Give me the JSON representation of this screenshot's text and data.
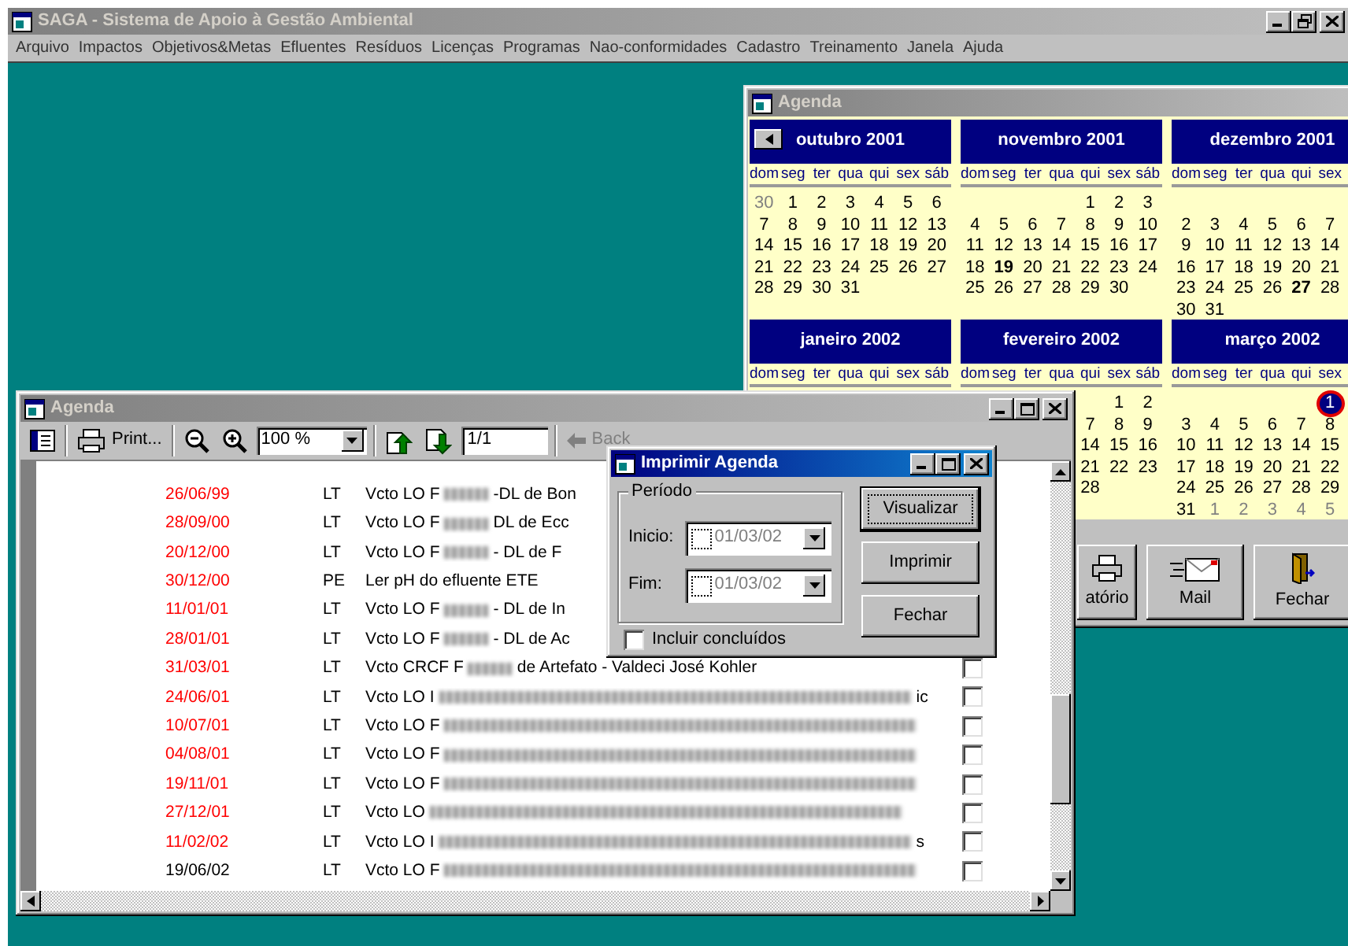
{
  "app": {
    "title": "SAGA - Sistema de Apoio à Gestão Ambiental",
    "active": false,
    "title_buttons": [
      {
        "kind": "minimize"
      },
      {
        "kind": "restore"
      },
      {
        "kind": "close"
      }
    ]
  },
  "menu": [
    "Arquivo",
    "Impactos",
    "Objetivos&Metas",
    "Efluentes",
    "Resíduos",
    "Licenças",
    "Programas",
    "Nao-conformidades",
    "Cadastro",
    "Treinamento",
    "Janela",
    "Ajuda"
  ],
  "calendar_window": {
    "title": "Agenda",
    "active": false,
    "months": [
      {
        "title": "outubro 2001",
        "prev_button": true,
        "weekdays": [
          "dom",
          "seg",
          "ter",
          "qua",
          "qui",
          "sex",
          "sáb"
        ],
        "weeks": [
          [
            {
              "kind": "day",
              "day": "30",
              "muted": true,
              "selected": false
            },
            {
              "kind": "day",
              "day": "1",
              "selected": false
            },
            {
              "kind": "day",
              "day": "2",
              "selected": false
            },
            {
              "kind": "day",
              "day": "3",
              "selected": false
            },
            {
              "kind": "day",
              "day": "4",
              "selected": false
            },
            {
              "kind": "day",
              "day": "5",
              "selected": false
            },
            {
              "kind": "day",
              "day": "6",
              "selected": false
            }
          ],
          [
            {
              "kind": "day",
              "day": "7",
              "selected": false
            },
            {
              "kind": "day",
              "day": "8",
              "selected": false
            },
            {
              "kind": "day",
              "day": "9",
              "selected": false
            },
            {
              "kind": "day",
              "day": "10",
              "selected": false
            },
            {
              "kind": "day",
              "day": "11",
              "selected": false
            },
            {
              "kind": "day",
              "day": "12",
              "selected": false
            },
            {
              "kind": "day",
              "day": "13",
              "selected": false
            }
          ],
          [
            {
              "kind": "day",
              "day": "14",
              "selected": false
            },
            {
              "kind": "day",
              "day": "15",
              "selected": false
            },
            {
              "kind": "day",
              "day": "16",
              "selected": false
            },
            {
              "kind": "day",
              "day": "17",
              "selected": false
            },
            {
              "kind": "day",
              "day": "18",
              "selected": false
            },
            {
              "kind": "day",
              "day": "19",
              "selected": false
            },
            {
              "kind": "day",
              "day": "20",
              "selected": false
            }
          ],
          [
            {
              "kind": "day",
              "day": "21",
              "selected": false
            },
            {
              "kind": "day",
              "day": "22",
              "selected": false
            },
            {
              "kind": "day",
              "day": "23",
              "selected": false
            },
            {
              "kind": "day",
              "day": "24",
              "selected": false
            },
            {
              "kind": "day",
              "day": "25",
              "selected": false
            },
            {
              "kind": "day",
              "day": "26",
              "selected": false
            },
            {
              "kind": "day",
              "day": "27",
              "selected": false
            }
          ],
          [
            {
              "kind": "day",
              "day": "28",
              "selected": false
            },
            {
              "kind": "day",
              "day": "29",
              "selected": false
            },
            {
              "kind": "day",
              "day": "30",
              "selected": false
            },
            {
              "kind": "day",
              "day": "31",
              "selected": false
            }
          ]
        ]
      },
      {
        "title": "novembro 2001",
        "weekdays": [
          "dom",
          "seg",
          "ter",
          "qua",
          "qui",
          "sex",
          "sáb"
        ],
        "weeks": [
          [
            {
              "kind": "blank"
            },
            {
              "kind": "blank"
            },
            {
              "kind": "blank"
            },
            {
              "kind": "blank"
            },
            {
              "kind": "day",
              "day": "1",
              "selected": false
            },
            {
              "kind": "day",
              "day": "2",
              "selected": false
            },
            {
              "kind": "day",
              "day": "3",
              "selected": false
            }
          ],
          [
            {
              "kind": "day",
              "day": "4",
              "selected": false
            },
            {
              "kind": "day",
              "day": "5",
              "selected": false
            },
            {
              "kind": "day",
              "day": "6",
              "selected": false
            },
            {
              "kind": "day",
              "day": "7",
              "selected": false
            },
            {
              "kind": "day",
              "day": "8",
              "selected": false
            },
            {
              "kind": "day",
              "day": "9",
              "selected": false
            },
            {
              "kind": "day",
              "day": "10",
              "selected": false
            }
          ],
          [
            {
              "kind": "day",
              "day": "11",
              "selected": false
            },
            {
              "kind": "day",
              "day": "12",
              "selected": false
            },
            {
              "kind": "day",
              "day": "13",
              "selected": false
            },
            {
              "kind": "day",
              "day": "14",
              "selected": false
            },
            {
              "kind": "day",
              "day": "15",
              "selected": false
            },
            {
              "kind": "day",
              "day": "16",
              "selected": false
            },
            {
              "kind": "day",
              "day": "17",
              "selected": false
            }
          ],
          [
            {
              "kind": "day",
              "day": "18",
              "selected": false
            },
            {
              "kind": "day",
              "day": "19",
              "bold": true,
              "selected": false
            },
            {
              "kind": "day",
              "day": "20",
              "selected": false
            },
            {
              "kind": "day",
              "day": "21",
              "selected": false
            },
            {
              "kind": "day",
              "day": "22",
              "selected": false
            },
            {
              "kind": "day",
              "day": "23",
              "selected": false
            },
            {
              "kind": "day",
              "day": "24",
              "selected": false
            }
          ],
          [
            {
              "kind": "day",
              "day": "25",
              "selected": false
            },
            {
              "kind": "day",
              "day": "26",
              "selected": false
            },
            {
              "kind": "day",
              "day": "27",
              "selected": false
            },
            {
              "kind": "day",
              "day": "28",
              "selected": false
            },
            {
              "kind": "day",
              "day": "29",
              "selected": false
            },
            {
              "kind": "day",
              "day": "30",
              "selected": false
            }
          ]
        ]
      },
      {
        "title": "dezembro 2001",
        "weekdays": [
          "dom",
          "seg",
          "ter",
          "qua",
          "qui",
          "sex"
        ],
        "weeks": [
          [
            {
              "kind": "blank"
            }
          ],
          [
            {
              "kind": "day",
              "day": "2",
              "selected": false
            },
            {
              "kind": "day",
              "day": "3",
              "selected": false
            },
            {
              "kind": "day",
              "day": "4",
              "selected": false
            },
            {
              "kind": "day",
              "day": "5",
              "selected": false
            },
            {
              "kind": "day",
              "day": "6",
              "selected": false
            },
            {
              "kind": "day",
              "day": "7",
              "selected": false
            }
          ],
          [
            {
              "kind": "day",
              "day": "9",
              "selected": false
            },
            {
              "kind": "day",
              "day": "10",
              "selected": false
            },
            {
              "kind": "day",
              "day": "11",
              "selected": false
            },
            {
              "kind": "day",
              "day": "12",
              "selected": false
            },
            {
              "kind": "day",
              "day": "13",
              "selected": false
            },
            {
              "kind": "day",
              "day": "14",
              "selected": false
            }
          ],
          [
            {
              "kind": "day",
              "day": "16",
              "selected": false
            },
            {
              "kind": "day",
              "day": "17",
              "selected": false
            },
            {
              "kind": "day",
              "day": "18",
              "selected": false
            },
            {
              "kind": "day",
              "day": "19",
              "selected": false
            },
            {
              "kind": "day",
              "day": "20",
              "selected": false
            },
            {
              "kind": "day",
              "day": "21",
              "selected": false
            }
          ],
          [
            {
              "kind": "day",
              "day": "23",
              "selected": false
            },
            {
              "kind": "day",
              "day": "24",
              "selected": false
            },
            {
              "kind": "day",
              "day": "25",
              "selected": false
            },
            {
              "kind": "day",
              "day": "26",
              "selected": false
            },
            {
              "kind": "day",
              "day": "27",
              "bold": true,
              "selected": false
            },
            {
              "kind": "day",
              "day": "28",
              "selected": false
            }
          ],
          [
            {
              "kind": "day",
              "day": "30",
              "selected": false
            },
            {
              "kind": "day",
              "day": "31",
              "selected": false
            }
          ]
        ]
      },
      {
        "title": "janeiro 2002",
        "weekdays": [
          "dom",
          "seg",
          "ter",
          "qua",
          "qui",
          "sex",
          "sáb"
        ]
      },
      {
        "title": "fevereiro 2002",
        "weekdays": [
          "dom",
          "seg",
          "ter",
          "qua",
          "qui",
          "sex",
          "sáb"
        ],
        "weeks": [
          [
            {
              "kind": "blank"
            },
            {
              "kind": "blank"
            },
            {
              "kind": "blank"
            },
            {
              "kind": "blank"
            },
            {
              "kind": "blank"
            },
            {
              "kind": "day",
              "day": "1",
              "selected": false
            },
            {
              "kind": "day",
              "day": "2",
              "selected": false
            }
          ],
          [
            {
              "kind": "blank"
            },
            {
              "kind": "blank"
            },
            {
              "kind": "blank"
            },
            {
              "kind": "blank"
            },
            {
              "kind": "day",
              "day": "7",
              "selected": false
            },
            {
              "kind": "day",
              "day": "8",
              "selected": false
            },
            {
              "kind": "day",
              "day": "9",
              "selected": false
            }
          ],
          [
            {
              "kind": "blank"
            },
            {
              "kind": "blank"
            },
            {
              "kind": "blank"
            },
            {
              "kind": "blank"
            },
            {
              "kind": "day",
              "day": "14",
              "selected": false
            },
            {
              "kind": "day",
              "day": "15",
              "selected": false
            },
            {
              "kind": "day",
              "day": "16",
              "selected": false
            }
          ],
          [
            {
              "kind": "blank"
            },
            {
              "kind": "blank"
            },
            {
              "kind": "blank"
            },
            {
              "kind": "blank"
            },
            {
              "kind": "day",
              "day": "21",
              "selected": false
            },
            {
              "kind": "day",
              "day": "22",
              "selected": false
            },
            {
              "kind": "day",
              "day": "23",
              "selected": false
            }
          ],
          [
            {
              "kind": "blank"
            },
            {
              "kind": "blank"
            },
            {
              "kind": "blank"
            },
            {
              "kind": "blank"
            },
            {
              "kind": "day",
              "day": "28",
              "selected": false
            }
          ]
        ]
      },
      {
        "title": "março 2002",
        "weekdays": [
          "dom",
          "seg",
          "ter",
          "qua",
          "qui",
          "sex"
        ],
        "weeks": [
          [
            {
              "kind": "blank"
            },
            {
              "kind": "blank"
            },
            {
              "kind": "blank"
            },
            {
              "kind": "blank"
            },
            {
              "kind": "blank"
            },
            {
              "kind": "day",
              "day": "1",
              "selected": true
            }
          ],
          [
            {
              "kind": "day",
              "day": "3",
              "selected": false
            },
            {
              "kind": "day",
              "day": "4",
              "selected": false
            },
            {
              "kind": "day",
              "day": "5",
              "selected": false
            },
            {
              "kind": "day",
              "day": "6",
              "selected": false
            },
            {
              "kind": "day",
              "day": "7",
              "selected": false
            },
            {
              "kind": "day",
              "day": "8",
              "selected": false
            }
          ],
          [
            {
              "kind": "day",
              "day": "10",
              "selected": false
            },
            {
              "kind": "day",
              "day": "11",
              "selected": false
            },
            {
              "kind": "day",
              "day": "12",
              "selected": false
            },
            {
              "kind": "day",
              "day": "13",
              "selected": false
            },
            {
              "kind": "day",
              "day": "14",
              "selected": false
            },
            {
              "kind": "day",
              "day": "15",
              "selected": false
            }
          ],
          [
            {
              "kind": "day",
              "day": "17",
              "selected": false
            },
            {
              "kind": "day",
              "day": "18",
              "selected": false
            },
            {
              "kind": "day",
              "day": "19",
              "selected": false
            },
            {
              "kind": "day",
              "day": "20",
              "selected": false
            },
            {
              "kind": "day",
              "day": "21",
              "selected": false
            },
            {
              "kind": "day",
              "day": "22",
              "selected": false
            }
          ],
          [
            {
              "kind": "day",
              "day": "24",
              "selected": false
            },
            {
              "kind": "day",
              "day": "25",
              "selected": false
            },
            {
              "kind": "day",
              "day": "26",
              "selected": false
            },
            {
              "kind": "day",
              "day": "27",
              "selected": false
            },
            {
              "kind": "day",
              "day": "28",
              "selected": false
            },
            {
              "kind": "day",
              "day": "29",
              "selected": false
            }
          ],
          [
            {
              "kind": "day",
              "day": "31",
              "selected": false
            },
            {
              "kind": "day",
              "day": "1",
              "muted": true,
              "selected": false
            },
            {
              "kind": "day",
              "day": "2",
              "muted": true,
              "selected": false
            },
            {
              "kind": "day",
              "day": "3",
              "muted": true,
              "selected": false
            },
            {
              "kind": "day",
              "day": "4",
              "muted": true,
              "selected": false
            },
            {
              "kind": "day",
              "day": "5",
              "muted": true,
              "selected": false
            }
          ]
        ]
      }
    ],
    "buttons": [
      {
        "kind": "report",
        "label": "atório"
      },
      {
        "kind": "mail",
        "label": "Mail"
      },
      {
        "kind": "close",
        "label": "Fechar"
      }
    ]
  },
  "agenda_window": {
    "title": "Agenda",
    "active": false,
    "title_buttons": [
      {
        "kind": "minimize"
      },
      {
        "kind": "maximize"
      },
      {
        "kind": "close"
      }
    ],
    "toolbar": {
      "print": "Print...",
      "zoom": "100 %",
      "page": "1/1",
      "back": "Back",
      "back_disabled": true
    },
    "rows": [
      {
        "date": "26/06/99",
        "overdue": true,
        "type": "LT",
        "start": "Vcto LO F",
        "redacted": true,
        "end": "-DL de Bon"
      },
      {
        "date": "28/09/00",
        "overdue": true,
        "type": "LT",
        "start": "Vcto LO F",
        "redacted": true,
        "end": "DL de Ecc"
      },
      {
        "date": "20/12/00",
        "overdue": true,
        "type": "LT",
        "start": "Vcto LO F",
        "redacted": true,
        "end": "- DL de F"
      },
      {
        "date": "30/12/00",
        "overdue": true,
        "type": "PE",
        "start": "Ler pH do efluente ETE",
        "redacted": false
      },
      {
        "date": "11/01/01",
        "overdue": true,
        "type": "LT",
        "start": "Vcto LO F",
        "redacted": true,
        "end": "- DL de In"
      },
      {
        "date": "28/01/01",
        "overdue": true,
        "type": "LT",
        "start": "Vcto LO F",
        "redacted": true,
        "end": "- DL de Ac"
      },
      {
        "date": "31/03/01",
        "overdue": true,
        "type": "LT",
        "start": "Vcto CRCF F",
        "redacted": true,
        "end": "de Artefato - Valdeci José Kohler",
        "done": false
      },
      {
        "date": "24/06/01",
        "overdue": true,
        "type": "LT",
        "start": "Vcto LO I",
        "redacted": true,
        "tail": "ic",
        "done": false
      },
      {
        "date": "10/07/01",
        "overdue": true,
        "type": "LT",
        "start": "Vcto LO F",
        "redacted": true,
        "done": false
      },
      {
        "date": "04/08/01",
        "overdue": true,
        "type": "LT",
        "start": "Vcto LO F",
        "redacted": true,
        "done": false
      },
      {
        "date": "19/11/01",
        "overdue": true,
        "type": "LT",
        "start": "Vcto LO F",
        "redacted": true,
        "done": false
      },
      {
        "date": "27/12/01",
        "overdue": true,
        "type": "LT",
        "start": "Vcto LO",
        "redacted": true,
        "done": false
      },
      {
        "date": "11/02/02",
        "overdue": true,
        "type": "LT",
        "start": "Vcto LO I",
        "redacted": true,
        "tail": "s",
        "done": false
      },
      {
        "date": "19/06/02",
        "overdue": false,
        "type": "LT",
        "start": "Vcto LO F",
        "redacted": true,
        "done": false
      }
    ]
  },
  "dialog": {
    "title": "Imprimir Agenda",
    "active": true,
    "title_buttons": [
      {
        "kind": "minimize"
      },
      {
        "kind": "maximize"
      },
      {
        "kind": "close"
      }
    ],
    "group_label": "Período",
    "dates": [
      {
        "label": "Inicio:",
        "value": "01/03/02",
        "enabled": false
      },
      {
        "label": "Fim:",
        "value": "01/03/02",
        "enabled": false
      }
    ],
    "include": {
      "label": "Incluir concluídos",
      "checked": false
    },
    "buttons": [
      {
        "label": "Visualizar",
        "default": true
      },
      {
        "label": "Imprimir",
        "default": false
      },
      {
        "label": "Fechar",
        "default": false
      }
    ]
  }
}
